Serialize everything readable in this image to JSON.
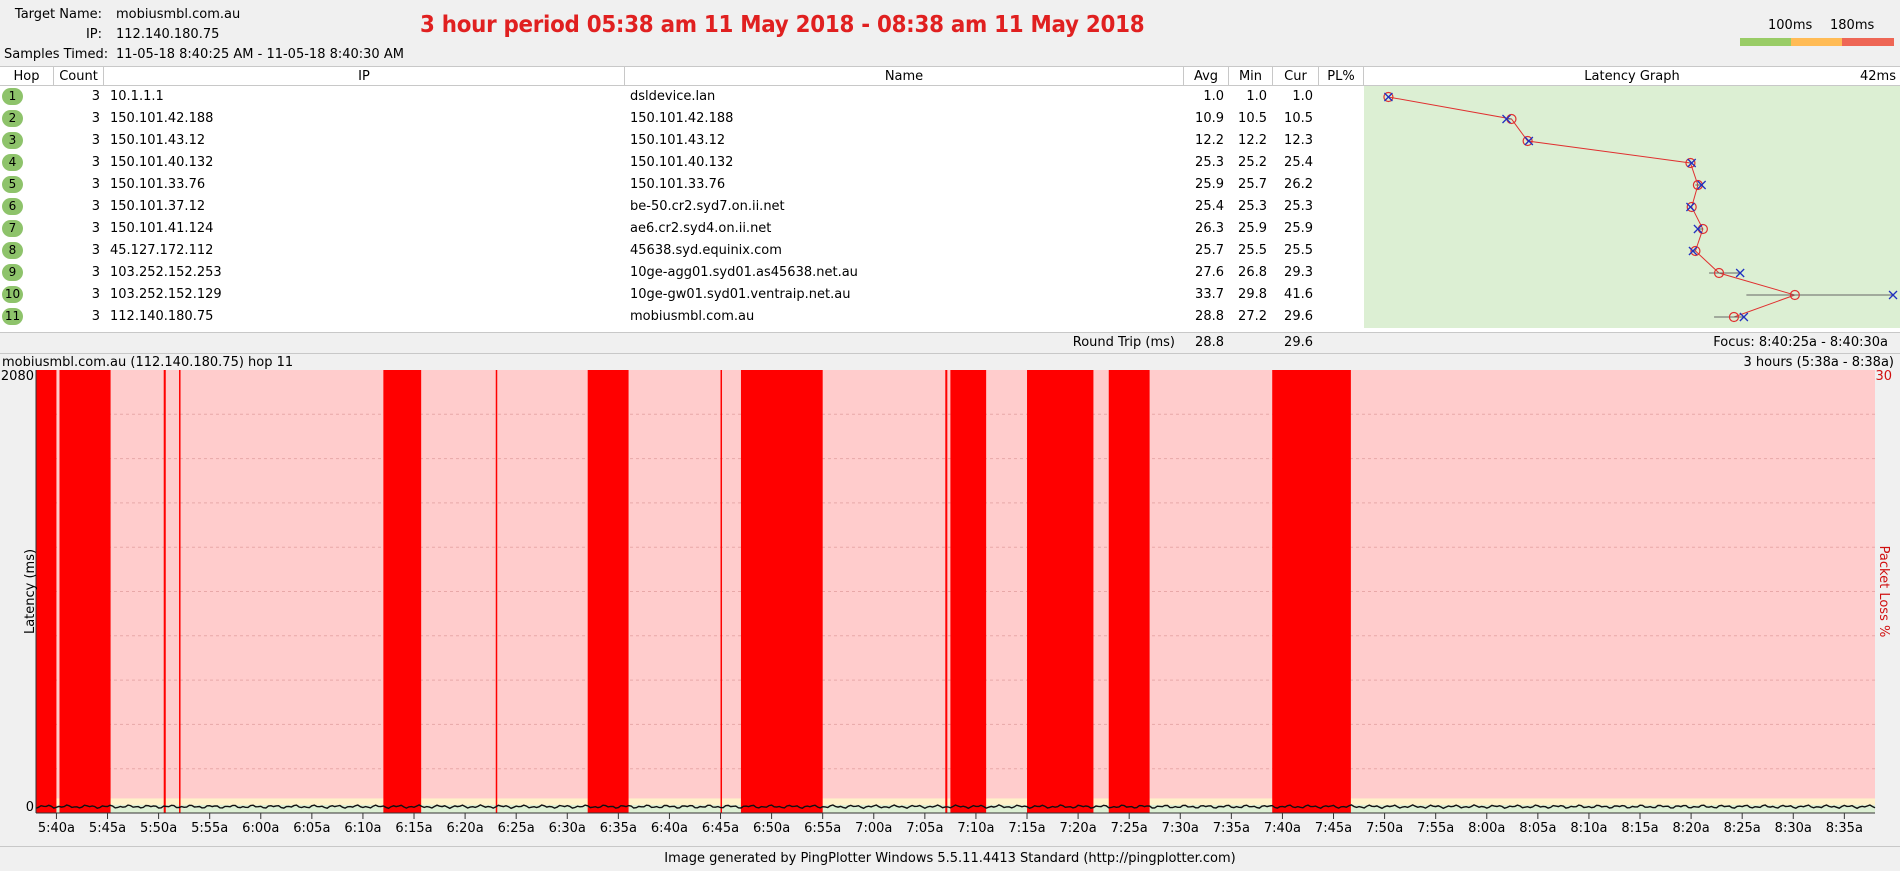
{
  "header": {
    "target_name_label": "Target Name:",
    "target_name": "mobiusmbl.com.au",
    "ip_label": "IP:",
    "ip": "112.140.180.75",
    "samples_label": "Samples Timed:",
    "samples": "11-05-18 8:40:25 AM - 11-05-18 8:40:30 AM",
    "banner": "3 hour period 05:38 am 11 May 2018 - 08:38 am 11 May 2018",
    "threshold_1": "100ms",
    "threshold_2": "180ms",
    "threshold_colors": [
      "#99cc66",
      "#ffbb55",
      "#ee6655"
    ]
  },
  "table": {
    "columns": [
      "Hop",
      "Count",
      "IP",
      "Name",
      "Avg",
      "Min",
      "Cur",
      "PL%",
      "Latency Graph"
    ],
    "graph_scale": "42ms",
    "rows": [
      {
        "hop": "1",
        "count": "3",
        "ip": "10.1.1.1",
        "name": "dsldevice.lan",
        "avg": "1.0",
        "min": "1.0",
        "cur": "1.0",
        "pl": ""
      },
      {
        "hop": "2",
        "count": "3",
        "ip": "150.101.42.188",
        "name": "150.101.42.188",
        "avg": "10.9",
        "min": "10.5",
        "cur": "10.5",
        "pl": ""
      },
      {
        "hop": "3",
        "count": "3",
        "ip": "150.101.43.12",
        "name": "150.101.43.12",
        "avg": "12.2",
        "min": "12.2",
        "cur": "12.3",
        "pl": ""
      },
      {
        "hop": "4",
        "count": "3",
        "ip": "150.101.40.132",
        "name": "150.101.40.132",
        "avg": "25.3",
        "min": "25.2",
        "cur": "25.4",
        "pl": ""
      },
      {
        "hop": "5",
        "count": "3",
        "ip": "150.101.33.76",
        "name": "150.101.33.76",
        "avg": "25.9",
        "min": "25.7",
        "cur": "26.2",
        "pl": ""
      },
      {
        "hop": "6",
        "count": "3",
        "ip": "150.101.37.12",
        "name": "be-50.cr2.syd7.on.ii.net",
        "avg": "25.4",
        "min": "25.3",
        "cur": "25.3",
        "pl": ""
      },
      {
        "hop": "7",
        "count": "3",
        "ip": "150.101.41.124",
        "name": "ae6.cr2.syd4.on.ii.net",
        "avg": "26.3",
        "min": "25.9",
        "cur": "25.9",
        "pl": ""
      },
      {
        "hop": "8",
        "count": "3",
        "ip": "45.127.172.112",
        "name": "45638.syd.equinix.com",
        "avg": "25.7",
        "min": "25.5",
        "cur": "25.5",
        "pl": ""
      },
      {
        "hop": "9",
        "count": "3",
        "ip": "103.252.152.253",
        "name": "10ge-agg01.syd01.as45638.net.au",
        "avg": "27.6",
        "min": "26.8",
        "cur": "29.3",
        "pl": ""
      },
      {
        "hop": "10",
        "count": "3",
        "ip": "103.252.152.129",
        "name": "10ge-gw01.syd01.ventraip.net.au",
        "avg": "33.7",
        "min": "29.8",
        "cur": "41.6",
        "pl": ""
      },
      {
        "hop": "11",
        "count": "3",
        "ip": "112.140.180.75",
        "name": "mobiusmbl.com.au",
        "avg": "28.8",
        "min": "27.2",
        "cur": "29.6",
        "pl": ""
      }
    ],
    "latency_graph": {
      "max_ms": 42,
      "hops": [
        {
          "avg": 1.0,
          "min": 1.0,
          "cur": 1.0
        },
        {
          "avg": 10.9,
          "min": 10.5,
          "cur": 10.5
        },
        {
          "avg": 12.2,
          "min": 12.2,
          "cur": 12.3
        },
        {
          "avg": 25.3,
          "min": 25.2,
          "cur": 25.4
        },
        {
          "avg": 25.9,
          "min": 25.7,
          "cur": 26.2
        },
        {
          "avg": 25.4,
          "min": 25.3,
          "cur": 25.3
        },
        {
          "avg": 26.3,
          "min": 25.9,
          "cur": 25.9
        },
        {
          "avg": 25.7,
          "min": 25.5,
          "cur": 25.5
        },
        {
          "avg": 27.6,
          "min": 26.8,
          "cur": 29.3
        },
        {
          "avg": 33.7,
          "min": 29.8,
          "cur": 41.6
        },
        {
          "avg": 28.8,
          "min": 27.2,
          "cur": 29.6
        }
      ]
    },
    "round_trip_label": "Round Trip (ms)",
    "round_trip_avg": "28.8",
    "round_trip_cur": "29.6",
    "focus": "Focus: 8:40:25a - 8:40:30a"
  },
  "timeline": {
    "title": "mobiusmbl.com.au (112.140.180.75) hop 11",
    "range": "3 hours (5:38a - 8:38a)"
  },
  "chart_data": {
    "type": "area",
    "ylabel": "Latency (ms)",
    "y2label": "Packet Loss %",
    "ylim": [
      0,
      2080
    ],
    "y_ticks": [
      "2080",
      "0"
    ],
    "y2_max_label": "30",
    "x_start": "5:38a",
    "x_end": "8:38a",
    "x_ticks": [
      "5:40a",
      "5:45a",
      "5:50a",
      "5:55a",
      "6:00a",
      "6:05a",
      "6:10a",
      "6:15a",
      "6:20a",
      "6:25a",
      "6:30a",
      "6:35a",
      "6:40a",
      "6:45a",
      "6:50a",
      "6:55a",
      "7:00a",
      "7:05a",
      "7:10a",
      "7:15a",
      "7:20a",
      "7:25a",
      "7:30a",
      "7:35a",
      "7:40a",
      "7:45a",
      "7:50a",
      "7:55a",
      "8:00a",
      "8:05a",
      "8:10a",
      "8:15a",
      "8:20a",
      "8:25a",
      "8:30a",
      "8:35a"
    ],
    "latency_baseline_ms": 30,
    "packet_loss_periods": [
      {
        "start": "5:38a",
        "end": "5:40a"
      },
      {
        "start": "5:40.3a",
        "end": "5:45.3a"
      },
      {
        "start": "5:50.5a",
        "end": "5:50.7a"
      },
      {
        "start": "5:52a",
        "end": "5:52.1a"
      },
      {
        "start": "6:12a",
        "end": "6:15.7a"
      },
      {
        "start": "6:23a",
        "end": "6:23.1a"
      },
      {
        "start": "6:32a",
        "end": "6:36a"
      },
      {
        "start": "6:45a",
        "end": "6:45.1a"
      },
      {
        "start": "6:47a",
        "end": "6:55a"
      },
      {
        "start": "7:07a",
        "end": "7:07.2a"
      },
      {
        "start": "7:07.5a",
        "end": "7:11a"
      },
      {
        "start": "7:15a",
        "end": "7:21.5a"
      },
      {
        "start": "7:23a",
        "end": "7:27a"
      },
      {
        "start": "7:39a",
        "end": "7:46.7a"
      }
    ]
  },
  "footer": {
    "text": "Image generated by PingPlotter Windows 5.5.11.4413 Standard (http://pingplotter.com)"
  }
}
